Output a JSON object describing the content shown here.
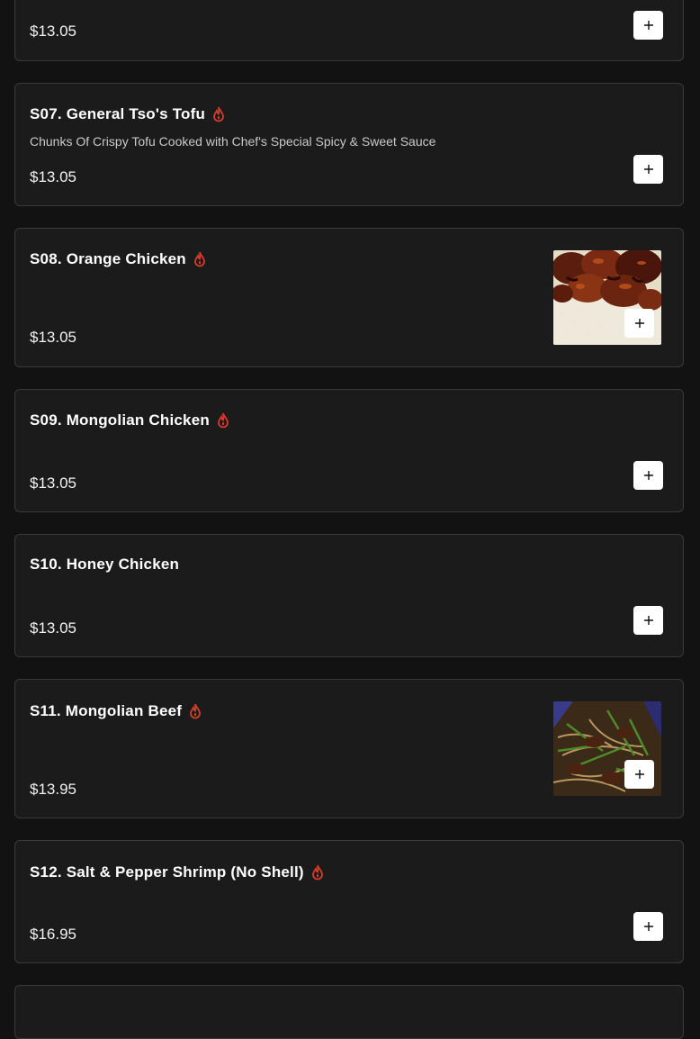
{
  "colors": {
    "background": "#121212",
    "card": "#1b1b1b",
    "border": "#3a3a3a",
    "spicy": "#d83b2b",
    "add_button": "#ffffff"
  },
  "icons": {
    "spicy": "flame-icon",
    "add": "plus-icon"
  },
  "items": [
    {
      "name": "",
      "description": "",
      "price": "$13.05",
      "spicy": false,
      "photo": false
    },
    {
      "name": "S07. General Tso's Tofu",
      "description": "Chunks Of Crispy Tofu Cooked with Chef's Special Spicy & Sweet Sauce",
      "price": "$13.05",
      "spicy": true,
      "photo": false
    },
    {
      "name": "S08. Orange Chicken",
      "description": "",
      "price": "$13.05",
      "spicy": true,
      "photo": true
    },
    {
      "name": "S09. Mongolian Chicken",
      "description": "",
      "price": "$13.05",
      "spicy": true,
      "photo": false
    },
    {
      "name": "S10. Honey Chicken",
      "description": "",
      "price": "$13.05",
      "spicy": false,
      "photo": false
    },
    {
      "name": "S11. Mongolian Beef",
      "description": "",
      "price": "$13.95",
      "spicy": true,
      "photo": true
    },
    {
      "name": "S12. Salt & Pepper Shrimp (No Shell)",
      "description": "",
      "price": "$16.95",
      "spicy": true,
      "photo": false
    }
  ]
}
